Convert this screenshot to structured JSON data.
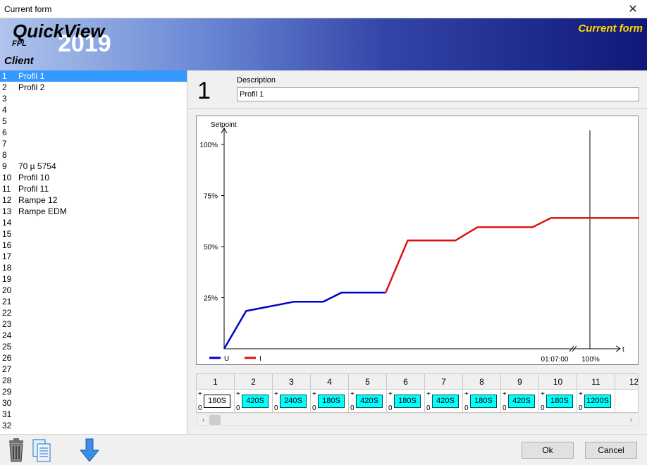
{
  "window": {
    "title": "Current form",
    "close_glyph": "✕"
  },
  "banner": {
    "brand": "QuickView",
    "year": "2019",
    "sub": "FPL",
    "client": "Client",
    "right_title": "Current form"
  },
  "profiles": [
    {
      "num": "1",
      "name": "Profil 1"
    },
    {
      "num": "2",
      "name": "Profil 2"
    },
    {
      "num": "3",
      "name": ""
    },
    {
      "num": "4",
      "name": ""
    },
    {
      "num": "5",
      "name": ""
    },
    {
      "num": "6",
      "name": ""
    },
    {
      "num": "7",
      "name": ""
    },
    {
      "num": "8",
      "name": ""
    },
    {
      "num": "9",
      "name": "70 µ 5754"
    },
    {
      "num": "10",
      "name": "Profil 10"
    },
    {
      "num": "11",
      "name": "Profil 11"
    },
    {
      "num": "12",
      "name": "Rampe 12"
    },
    {
      "num": "13",
      "name": "Rampe EDM"
    },
    {
      "num": "14",
      "name": ""
    },
    {
      "num": "15",
      "name": ""
    },
    {
      "num": "16",
      "name": ""
    },
    {
      "num": "17",
      "name": ""
    },
    {
      "num": "18",
      "name": ""
    },
    {
      "num": "19",
      "name": ""
    },
    {
      "num": "20",
      "name": ""
    },
    {
      "num": "21",
      "name": ""
    },
    {
      "num": "22",
      "name": ""
    },
    {
      "num": "23",
      "name": ""
    },
    {
      "num": "24",
      "name": ""
    },
    {
      "num": "25",
      "name": ""
    },
    {
      "num": "26",
      "name": ""
    },
    {
      "num": "27",
      "name": ""
    },
    {
      "num": "28",
      "name": ""
    },
    {
      "num": "29",
      "name": ""
    },
    {
      "num": "30",
      "name": ""
    },
    {
      "num": "31",
      "name": ""
    },
    {
      "num": "32",
      "name": ""
    }
  ],
  "selected_index": 0,
  "detail": {
    "number": "1",
    "description_label": "Description",
    "description_value": "Profil 1"
  },
  "chart_data": {
    "type": "line",
    "ylabel": "Setpoint",
    "xlabel": "t",
    "yticks": [
      "100%",
      "75%",
      "50%",
      "25%"
    ],
    "ylim": [
      0,
      100
    ],
    "x_end_label": "01:07:00",
    "marker_label": "100%",
    "series": [
      {
        "name": "U",
        "color": "#0000cc",
        "points": [
          [
            0,
            0
          ],
          [
            0.06,
            18.5
          ],
          [
            0.19,
            23
          ],
          [
            0.27,
            23
          ],
          [
            0.32,
            27.5
          ],
          [
            0.44,
            27.5
          ]
        ]
      },
      {
        "name": "I",
        "color": "#dd1111",
        "points": [
          [
            0.44,
            27.5
          ],
          [
            0.5,
            53
          ],
          [
            0.63,
            53
          ],
          [
            0.69,
            59.5
          ],
          [
            0.84,
            59.5
          ],
          [
            0.89,
            64
          ],
          [
            1.46,
            64
          ]
        ]
      }
    ]
  },
  "steps": {
    "headers": [
      "1",
      "2",
      "3",
      "4",
      "5",
      "6",
      "7",
      "8",
      "9",
      "10",
      "11",
      "12"
    ],
    "values": [
      "180S",
      "420S",
      "240S",
      "180S",
      "420S",
      "180S",
      "420S",
      "180S",
      "420S",
      "180S",
      "1200S"
    ],
    "plus": "+",
    "zero": "0"
  },
  "scrollbar": {
    "left": "‹",
    "right": "›"
  },
  "buttons": {
    "ok": "Ok",
    "cancel": "Cancel"
  }
}
